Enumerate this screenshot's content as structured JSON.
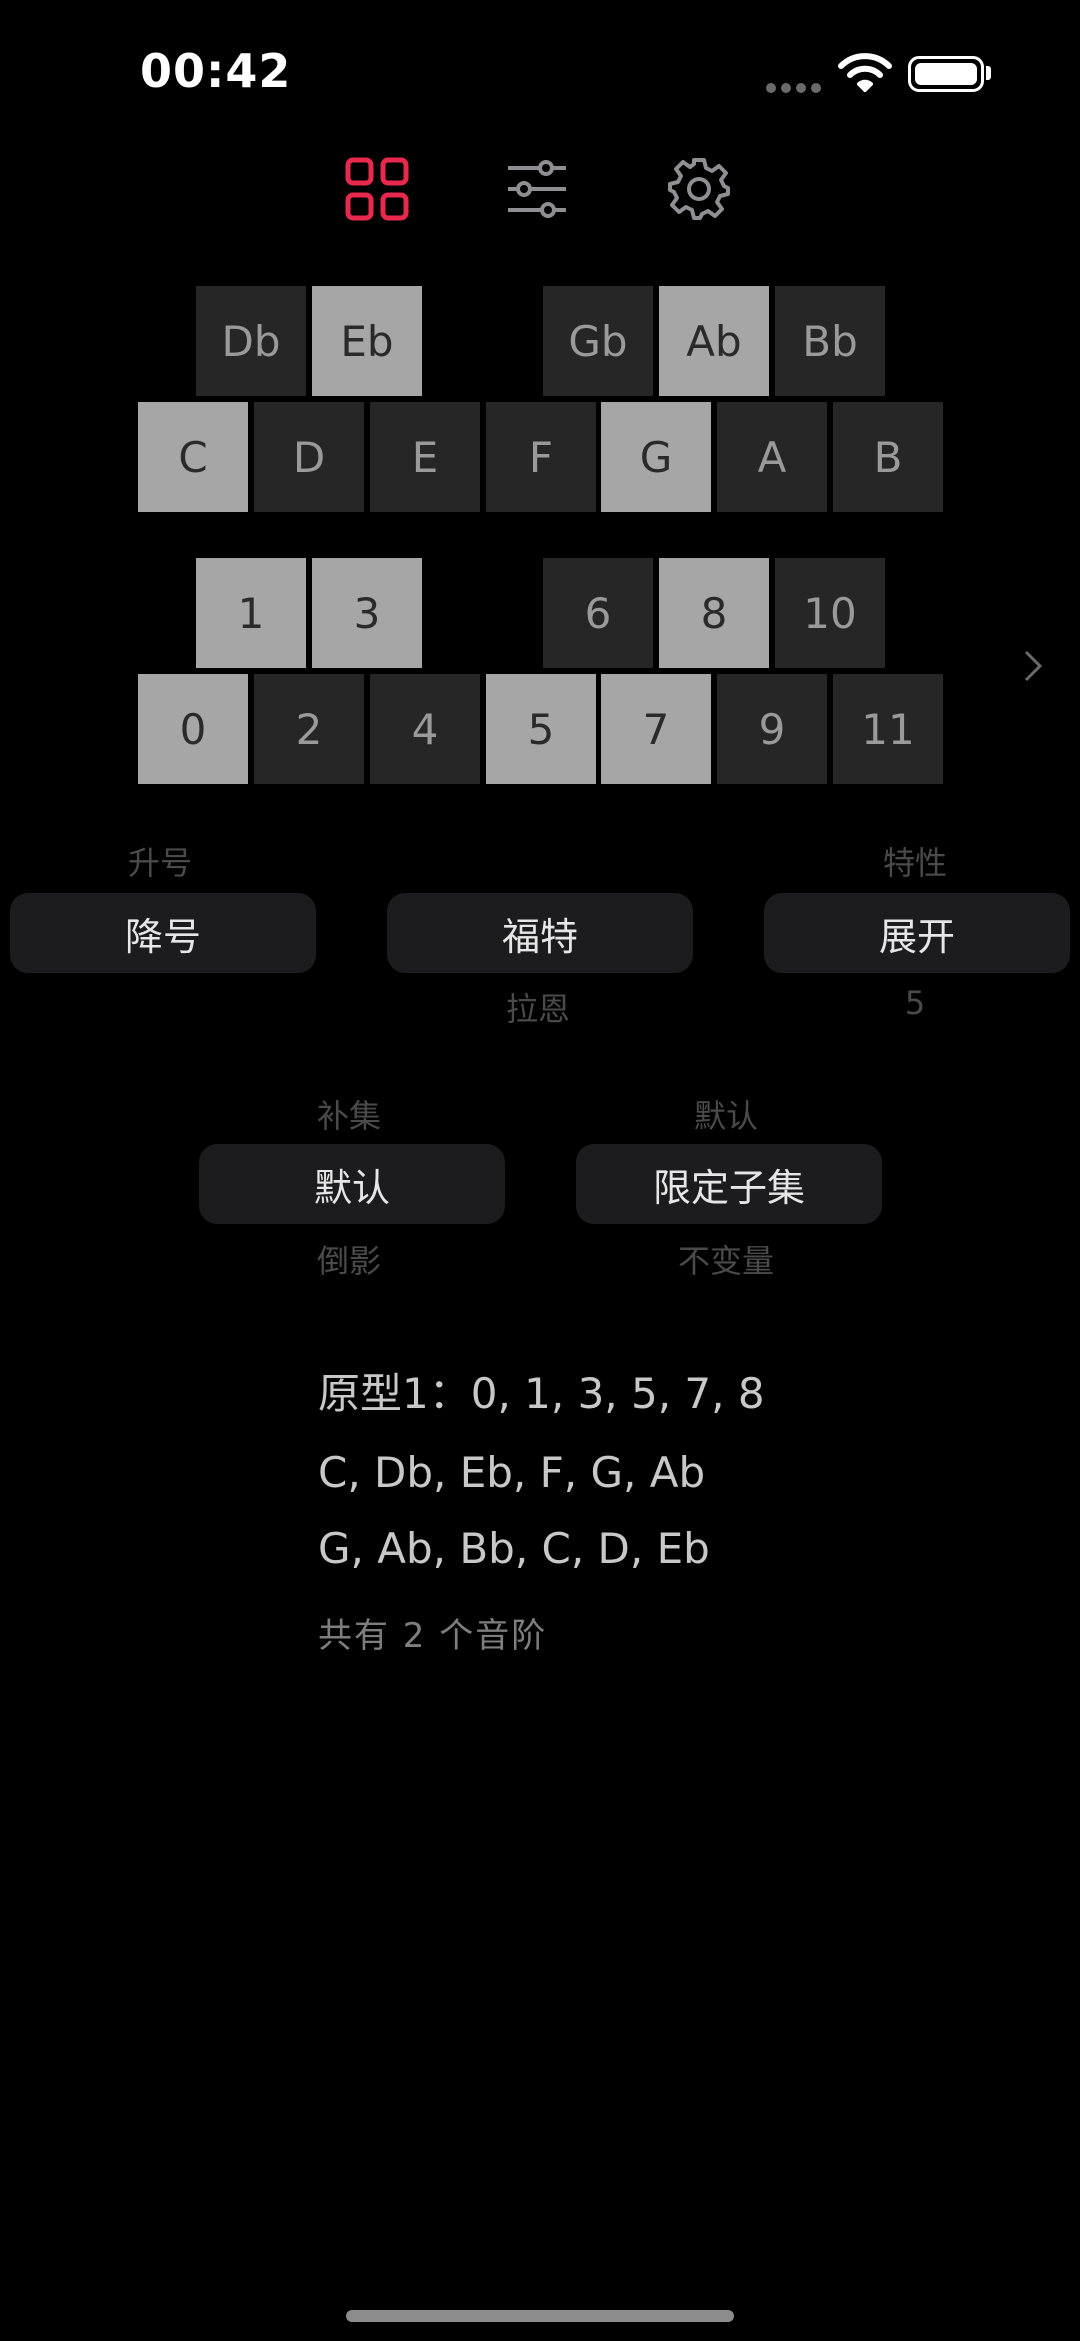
{
  "status_bar": {
    "time": "00:42"
  },
  "toolbar": {
    "icons": [
      "grid-icon",
      "sliders-icon",
      "gear-icon"
    ],
    "active_color": "#e8294d",
    "inactive_color": "#8e8e93"
  },
  "note_keys": {
    "black": [
      {
        "label": "Db",
        "on": false
      },
      {
        "label": "Eb",
        "on": true
      },
      {
        "label": "Gb",
        "on": false
      },
      {
        "label": "Ab",
        "on": true
      },
      {
        "label": "Bb",
        "on": false
      }
    ],
    "white": [
      {
        "label": "C",
        "on": true
      },
      {
        "label": "D",
        "on": false
      },
      {
        "label": "E",
        "on": false
      },
      {
        "label": "F",
        "on": false
      },
      {
        "label": "G",
        "on": true
      },
      {
        "label": "A",
        "on": false
      },
      {
        "label": "B",
        "on": false
      }
    ]
  },
  "number_keys": {
    "black": [
      {
        "label": "1",
        "on": true
      },
      {
        "label": "3",
        "on": true
      },
      {
        "label": "6",
        "on": false
      },
      {
        "label": "8",
        "on": true
      },
      {
        "label": "10",
        "on": false
      }
    ],
    "white": [
      {
        "label": "0",
        "on": true
      },
      {
        "label": "2",
        "on": false
      },
      {
        "label": "4",
        "on": false
      },
      {
        "label": "5",
        "on": true
      },
      {
        "label": "7",
        "on": true
      },
      {
        "label": "9",
        "on": false
      },
      {
        "label": "11",
        "on": false
      }
    ]
  },
  "pickers": {
    "accidental": {
      "above": "升号",
      "selected": "降号",
      "below": ""
    },
    "naming": {
      "above": "",
      "selected": "福特",
      "below": "拉恩"
    },
    "property": {
      "above": "特性",
      "selected": "展开",
      "below": "5"
    },
    "set_op": {
      "above": "补集",
      "selected": "默认",
      "below": "倒影"
    },
    "subset": {
      "above": "默认",
      "selected": "限定子集",
      "below": "不变量"
    }
  },
  "result": {
    "prime_form": "原型1：0, 1, 3, 5, 7, 8",
    "scales": [
      "C, Db, Eb, F, G, Ab",
      "G, Ab, Bb, C, D, Eb"
    ],
    "count": "共有 2 个音阶"
  }
}
